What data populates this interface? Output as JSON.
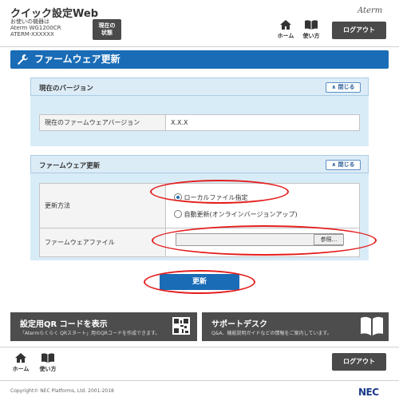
{
  "header": {
    "title": "クイック設定Web",
    "device_line1": "お使いの機器は",
    "device_line2": "Aterm WG1200CR",
    "device_line3": "ATERM-XXXXXX",
    "status_btn_line1": "現在の",
    "status_btn_line2": "状態",
    "brand": "Aterm",
    "home_label": "ホーム",
    "guide_label": "使い方",
    "logout_label": "ログアウト"
  },
  "page": {
    "title": "ファームウェア更新"
  },
  "version_section": {
    "title": "現在のバージョン",
    "close_label": "閉じる",
    "row_label": "現在のファームウェアバージョン",
    "row_value": "X.X.X"
  },
  "update_section": {
    "title": "ファームウェア更新",
    "close_label": "閉じる",
    "method_label": "更新方法",
    "option_local": "ローカルファイル指定",
    "option_auto": "自動更新(オンラインバージョンアップ)",
    "selected_option": "local",
    "file_label": "ファームウェアファイル",
    "file_value": "",
    "browse_label": "参照...",
    "update_button": "更新"
  },
  "footer": {
    "qr_title": "設定用QR コードを表示",
    "qr_desc": "「Atermらくらく QRスタート」用のQRコードを作成できます。",
    "support_title": "サポートデスク",
    "support_desc": "Q&A、機能説明ガイドなどの情報をご案内しています。",
    "home_label": "ホーム",
    "guide_label": "使い方",
    "logout_label": "ログアウト",
    "copyright": "Copyright© NEC Platforms, Ltd. 2001-2018",
    "logo": "NEC"
  },
  "colors": {
    "accent": "#1a6cb6",
    "highlight": "#e41e1e",
    "dark_button": "#4a4a4a"
  }
}
